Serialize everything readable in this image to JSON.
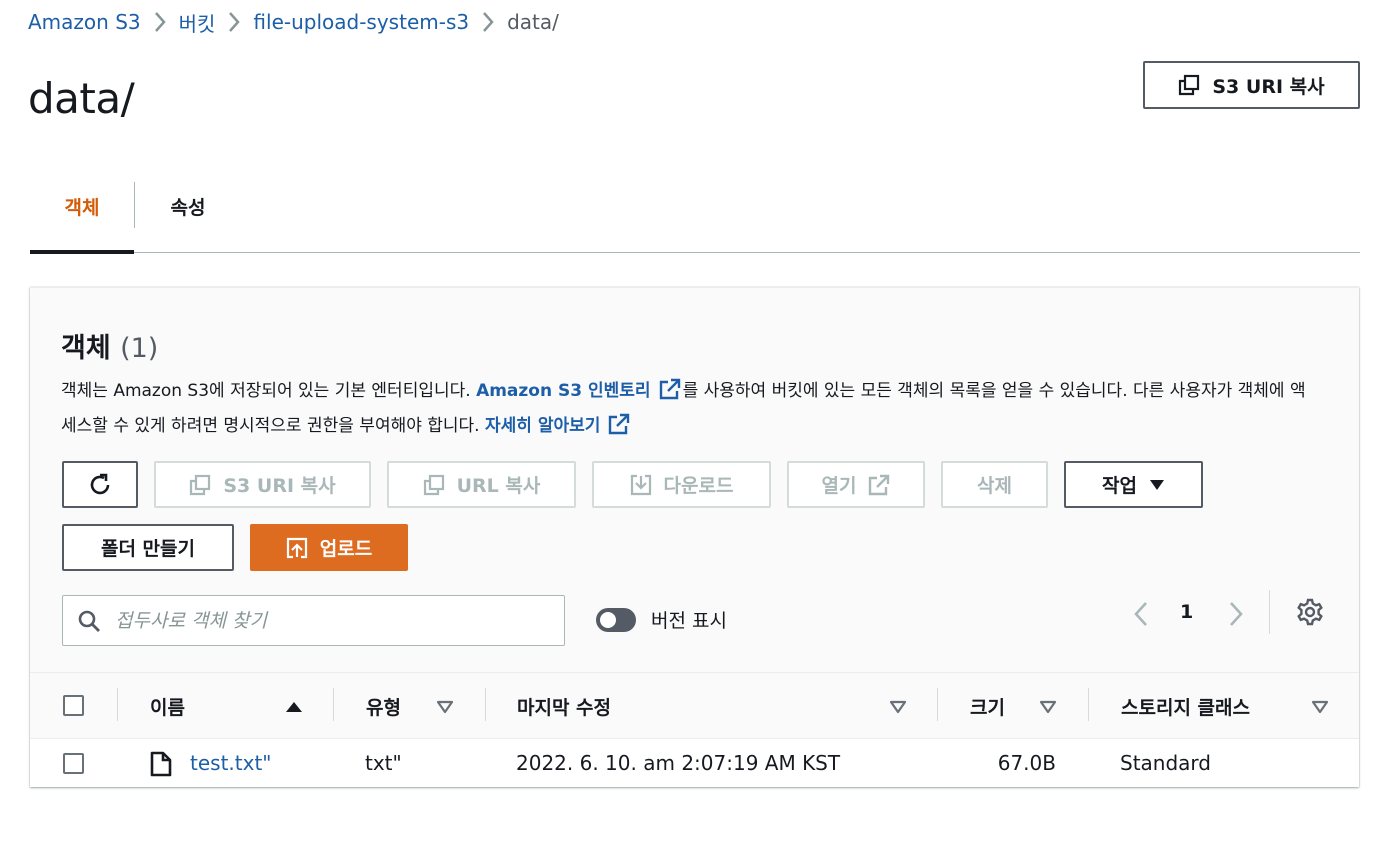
{
  "breadcrumb": {
    "items": [
      "Amazon S3",
      "버킷",
      "file-upload-system-s3"
    ],
    "current": "data/"
  },
  "page": {
    "title": "data/",
    "copy_uri_label": "S3 URI 복사"
  },
  "tabs": [
    {
      "label": "객체",
      "active": true
    },
    {
      "label": "속성",
      "active": false
    }
  ],
  "objects_panel": {
    "title": "객체",
    "count": "(1)",
    "description_1": "객체는 Amazon S3에 저장되어 있는 기본 엔터티입니다. ",
    "inventory_link": "Amazon S3 인벤토리",
    "description_2": "를 사용하여 버킷에 있는 모든 객체의 목록을 얻을 수 있습니다. 다른 사용자가 객체에 액세스할 수 있게 하려면 명시적으로 권한을 부여해야 합니다. ",
    "learn_more_link": "자세히 알아보기"
  },
  "toolbar": {
    "copy_uri": "S3 URI 복사",
    "copy_url": "URL 복사",
    "download": "다운로드",
    "open": "열기",
    "delete": "삭제",
    "actions": "작업",
    "create_folder": "폴더 만들기",
    "upload": "업로드"
  },
  "search": {
    "placeholder": "접두사로 객체 찾기"
  },
  "versions_toggle": {
    "label": "버전 표시",
    "on": false
  },
  "pagination": {
    "current_page": "1"
  },
  "table": {
    "columns": [
      "이름",
      "유형",
      "마지막 수정",
      "크기",
      "스토리지 클래스"
    ],
    "rows": [
      {
        "name": "test.txt\"",
        "type": "txt\"",
        "last_modified": "2022. 6. 10. am 2:07:19 AM KST",
        "size": "67.0B",
        "storage_class": "Standard"
      }
    ]
  },
  "colors": {
    "accent": "#d45b07",
    "primary_button": "#dd6b20",
    "link": "#1d5ea8",
    "text": "#16191f",
    "disabled": "#aab7b8"
  },
  "icons": [
    "chevron-right-icon",
    "copy-icon",
    "refresh-icon",
    "download-icon",
    "external-link-icon",
    "caret-down-icon",
    "upload-icon",
    "search-icon",
    "chevron-left-icon",
    "gear-icon",
    "sort-ascending-icon",
    "sort-descending-icon",
    "file-icon"
  ]
}
